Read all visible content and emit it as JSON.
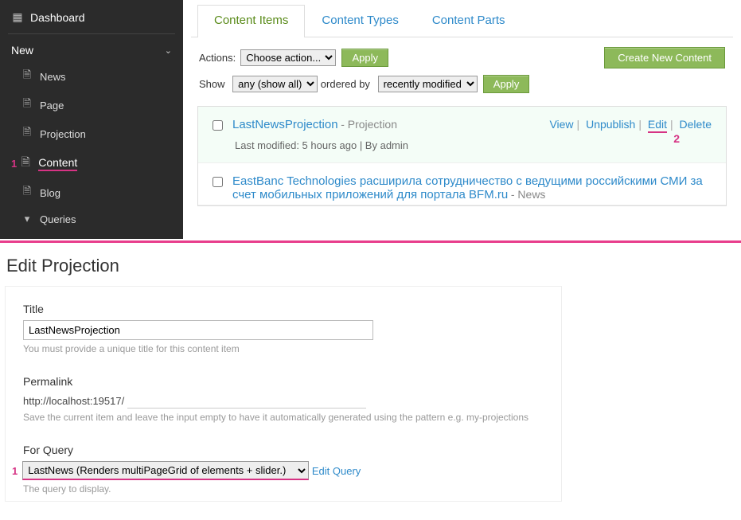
{
  "sidebar": {
    "dashboard": "Dashboard",
    "new": "New",
    "items": [
      {
        "label": "News"
      },
      {
        "label": "Page"
      },
      {
        "label": "Projection"
      }
    ],
    "content": "Content",
    "content_items": [
      {
        "label": "Blog"
      },
      {
        "label": "Queries"
      }
    ],
    "callout1": "1"
  },
  "tabs": {
    "content_items": "Content Items",
    "content_types": "Content Types",
    "content_parts": "Content Parts"
  },
  "toolbar": {
    "actions_label": "Actions:",
    "actions_value": "Choose action...",
    "apply": "Apply",
    "show_label": "Show",
    "show_value": "any (show all)",
    "ordered_by": "ordered by",
    "order_value": "recently modified",
    "create_new": "Create New Content"
  },
  "list": [
    {
      "title": "LastNewsProjection",
      "type": "Projection",
      "meta": "Last modified: 5 hours ago | By admin",
      "actions": {
        "view": "View",
        "unpublish": "Unpublish",
        "edit": "Edit",
        "delete": "Delete"
      },
      "callout2": "2"
    },
    {
      "title": "EastBanc Technologies расширила сотрудничество с ведущими российскими СМИ за счет мобильных приложений для портала BFM.ru",
      "type": "News"
    }
  ],
  "edit": {
    "heading": "Edit Projection",
    "title_label": "Title",
    "title_value": "LastNewsProjection",
    "title_hint": "You must provide a unique title for this content item",
    "permalink_label": "Permalink",
    "permalink_prefix": "http://localhost:19517/",
    "permalink_value": "",
    "permalink_hint": "Save the current item and leave the input empty to have it automatically generated using the pattern e.g. my-projections",
    "query_label": "For Query",
    "query_value": "LastNews (Renders multiPageGrid of elements + slider.)",
    "query_edit": "Edit Query",
    "query_hint": "The query to display.",
    "callout1": "1"
  }
}
